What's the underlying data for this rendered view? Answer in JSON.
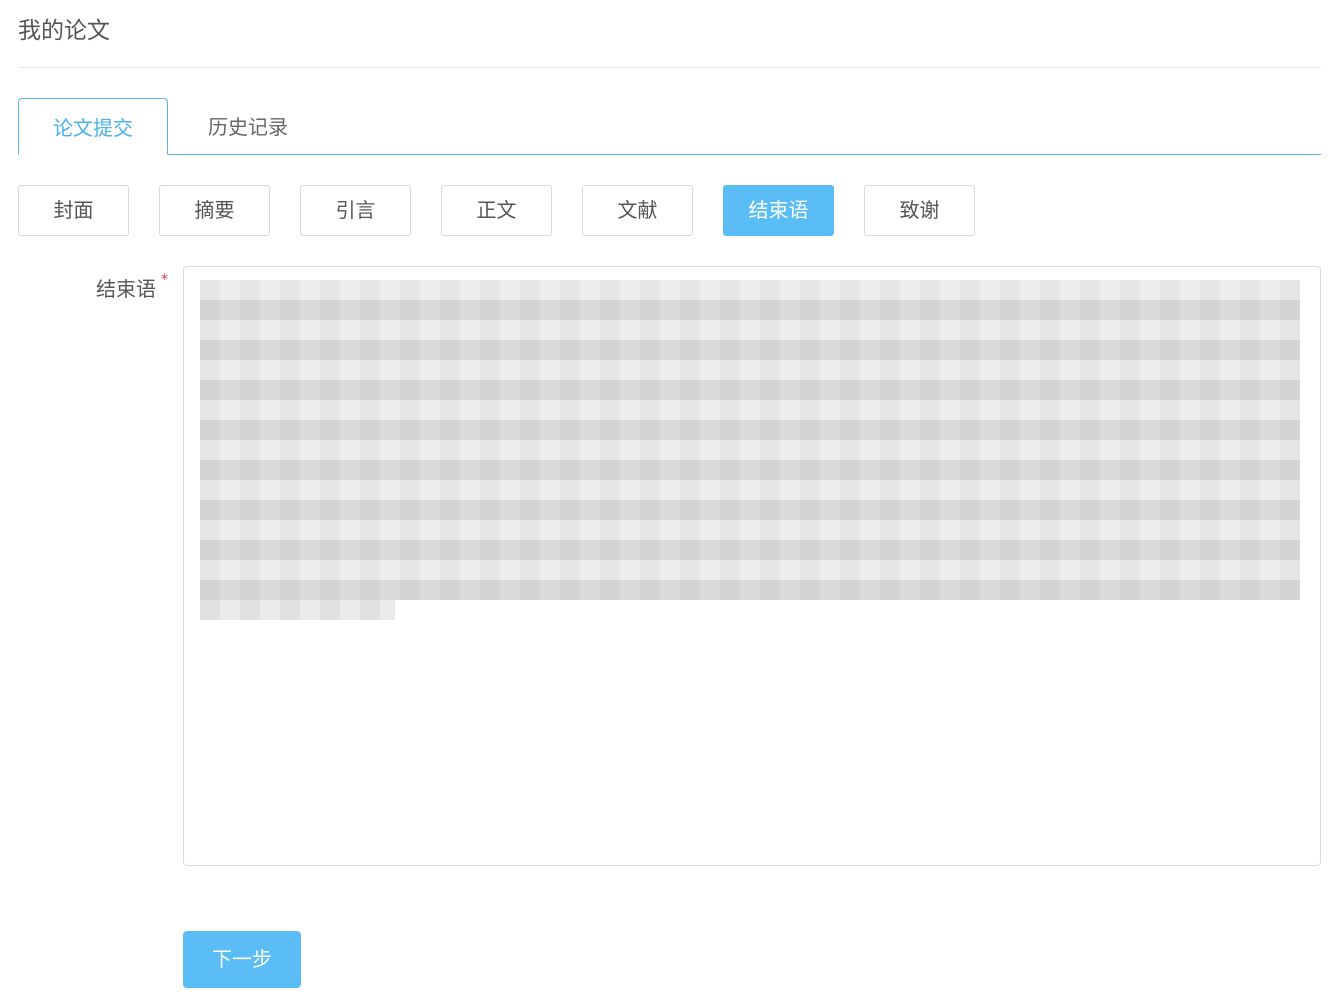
{
  "page": {
    "title": "我的论文"
  },
  "tabs": [
    {
      "label": "论文提交",
      "active": true
    },
    {
      "label": "历史记录",
      "active": false
    }
  ],
  "sections": [
    {
      "label": "封面",
      "active": false
    },
    {
      "label": "摘要",
      "active": false
    },
    {
      "label": "引言",
      "active": false
    },
    {
      "label": "正文",
      "active": false
    },
    {
      "label": "文献",
      "active": false
    },
    {
      "label": "结束语",
      "active": true
    },
    {
      "label": "致谢",
      "active": false
    }
  ],
  "form": {
    "field_label": "结束语",
    "required_mark": "*"
  },
  "actions": {
    "next_label": "下一步"
  },
  "colors": {
    "accent": "#5bbdf5",
    "tab_accent": "#4ab2ec",
    "required": "#e23b3b",
    "border": "#dcdcdc"
  }
}
